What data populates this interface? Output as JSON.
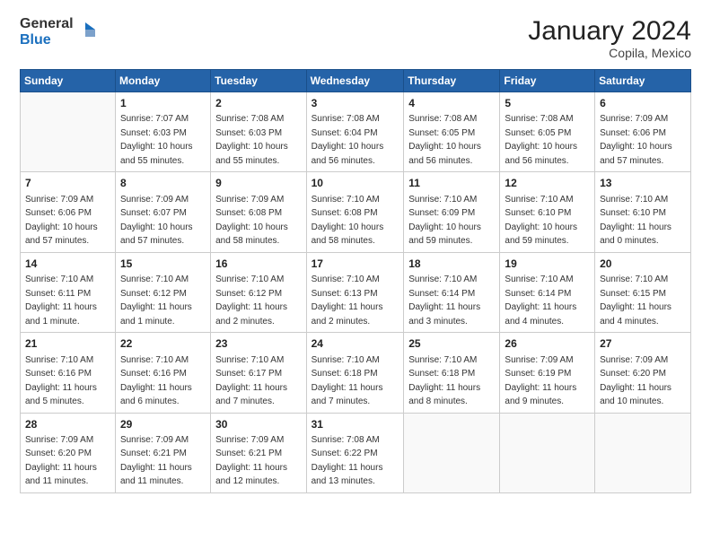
{
  "header": {
    "logo_line1": "General",
    "logo_line2": "Blue",
    "main_title": "January 2024",
    "subtitle": "Copila, Mexico"
  },
  "columns": [
    "Sunday",
    "Monday",
    "Tuesday",
    "Wednesday",
    "Thursday",
    "Friday",
    "Saturday"
  ],
  "weeks": [
    [
      {
        "day": "",
        "sunrise": "",
        "sunset": "",
        "daylight": ""
      },
      {
        "day": "1",
        "sunrise": "7:07 AM",
        "sunset": "6:03 PM",
        "daylight": "10 hours and 55 minutes."
      },
      {
        "day": "2",
        "sunrise": "7:08 AM",
        "sunset": "6:03 PM",
        "daylight": "10 hours and 55 minutes."
      },
      {
        "day": "3",
        "sunrise": "7:08 AM",
        "sunset": "6:04 PM",
        "daylight": "10 hours and 56 minutes."
      },
      {
        "day": "4",
        "sunrise": "7:08 AM",
        "sunset": "6:05 PM",
        "daylight": "10 hours and 56 minutes."
      },
      {
        "day": "5",
        "sunrise": "7:08 AM",
        "sunset": "6:05 PM",
        "daylight": "10 hours and 56 minutes."
      },
      {
        "day": "6",
        "sunrise": "7:09 AM",
        "sunset": "6:06 PM",
        "daylight": "10 hours and 57 minutes."
      }
    ],
    [
      {
        "day": "7",
        "sunrise": "7:09 AM",
        "sunset": "6:06 PM",
        "daylight": "10 hours and 57 minutes."
      },
      {
        "day": "8",
        "sunrise": "7:09 AM",
        "sunset": "6:07 PM",
        "daylight": "10 hours and 57 minutes."
      },
      {
        "day": "9",
        "sunrise": "7:09 AM",
        "sunset": "6:08 PM",
        "daylight": "10 hours and 58 minutes."
      },
      {
        "day": "10",
        "sunrise": "7:10 AM",
        "sunset": "6:08 PM",
        "daylight": "10 hours and 58 minutes."
      },
      {
        "day": "11",
        "sunrise": "7:10 AM",
        "sunset": "6:09 PM",
        "daylight": "10 hours and 59 minutes."
      },
      {
        "day": "12",
        "sunrise": "7:10 AM",
        "sunset": "6:10 PM",
        "daylight": "10 hours and 59 minutes."
      },
      {
        "day": "13",
        "sunrise": "7:10 AM",
        "sunset": "6:10 PM",
        "daylight": "11 hours and 0 minutes."
      }
    ],
    [
      {
        "day": "14",
        "sunrise": "7:10 AM",
        "sunset": "6:11 PM",
        "daylight": "11 hours and 1 minute."
      },
      {
        "day": "15",
        "sunrise": "7:10 AM",
        "sunset": "6:12 PM",
        "daylight": "11 hours and 1 minute."
      },
      {
        "day": "16",
        "sunrise": "7:10 AM",
        "sunset": "6:12 PM",
        "daylight": "11 hours and 2 minutes."
      },
      {
        "day": "17",
        "sunrise": "7:10 AM",
        "sunset": "6:13 PM",
        "daylight": "11 hours and 2 minutes."
      },
      {
        "day": "18",
        "sunrise": "7:10 AM",
        "sunset": "6:14 PM",
        "daylight": "11 hours and 3 minutes."
      },
      {
        "day": "19",
        "sunrise": "7:10 AM",
        "sunset": "6:14 PM",
        "daylight": "11 hours and 4 minutes."
      },
      {
        "day": "20",
        "sunrise": "7:10 AM",
        "sunset": "6:15 PM",
        "daylight": "11 hours and 4 minutes."
      }
    ],
    [
      {
        "day": "21",
        "sunrise": "7:10 AM",
        "sunset": "6:16 PM",
        "daylight": "11 hours and 5 minutes."
      },
      {
        "day": "22",
        "sunrise": "7:10 AM",
        "sunset": "6:16 PM",
        "daylight": "11 hours and 6 minutes."
      },
      {
        "day": "23",
        "sunrise": "7:10 AM",
        "sunset": "6:17 PM",
        "daylight": "11 hours and 7 minutes."
      },
      {
        "day": "24",
        "sunrise": "7:10 AM",
        "sunset": "6:18 PM",
        "daylight": "11 hours and 7 minutes."
      },
      {
        "day": "25",
        "sunrise": "7:10 AM",
        "sunset": "6:18 PM",
        "daylight": "11 hours and 8 minutes."
      },
      {
        "day": "26",
        "sunrise": "7:09 AM",
        "sunset": "6:19 PM",
        "daylight": "11 hours and 9 minutes."
      },
      {
        "day": "27",
        "sunrise": "7:09 AM",
        "sunset": "6:20 PM",
        "daylight": "11 hours and 10 minutes."
      }
    ],
    [
      {
        "day": "28",
        "sunrise": "7:09 AM",
        "sunset": "6:20 PM",
        "daylight": "11 hours and 11 minutes."
      },
      {
        "day": "29",
        "sunrise": "7:09 AM",
        "sunset": "6:21 PM",
        "daylight": "11 hours and 11 minutes."
      },
      {
        "day": "30",
        "sunrise": "7:09 AM",
        "sunset": "6:21 PM",
        "daylight": "11 hours and 12 minutes."
      },
      {
        "day": "31",
        "sunrise": "7:08 AM",
        "sunset": "6:22 PM",
        "daylight": "11 hours and 13 minutes."
      },
      {
        "day": "",
        "sunrise": "",
        "sunset": "",
        "daylight": ""
      },
      {
        "day": "",
        "sunrise": "",
        "sunset": "",
        "daylight": ""
      },
      {
        "day": "",
        "sunrise": "",
        "sunset": "",
        "daylight": ""
      }
    ]
  ],
  "labels": {
    "sunrise": "Sunrise:",
    "sunset": "Sunset:",
    "daylight": "Daylight:"
  }
}
